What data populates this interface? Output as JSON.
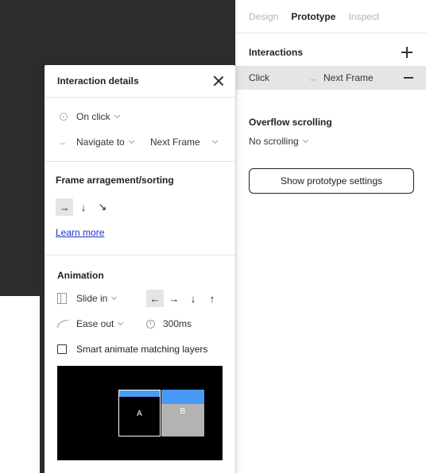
{
  "tabs": [
    "Design",
    "Prototype",
    "Inspect"
  ],
  "right_panel": {
    "interactions_title": "Interactions",
    "interaction": {
      "trigger": "Click",
      "destination": "Next Frame"
    },
    "overflow_title": "Overflow scrolling",
    "overflow_value": "No scrolling",
    "settings_button": "Show prototype settings"
  },
  "modal": {
    "title": "Interaction details",
    "trigger": "On click",
    "action": "Navigate to",
    "destination": "Next Frame",
    "frame_section_title": "Frame arragement/sorting",
    "sort_dirs": [
      "→",
      "↓",
      "↘"
    ],
    "learn_more": "Learn more",
    "animation_title": "Animation",
    "animation_type": "Slide in",
    "anim_dirs": [
      "←",
      "→",
      "↓",
      "↑"
    ],
    "easing": "Ease out",
    "duration": "300ms",
    "smart_animate_label": "Smart animate matching layers",
    "preview": {
      "frame_a": "A",
      "frame_b": "B"
    }
  },
  "colors": {
    "accent_blue": "#4a9af5",
    "link": "#1a2fd1",
    "canvas": "#2c2c2c"
  }
}
